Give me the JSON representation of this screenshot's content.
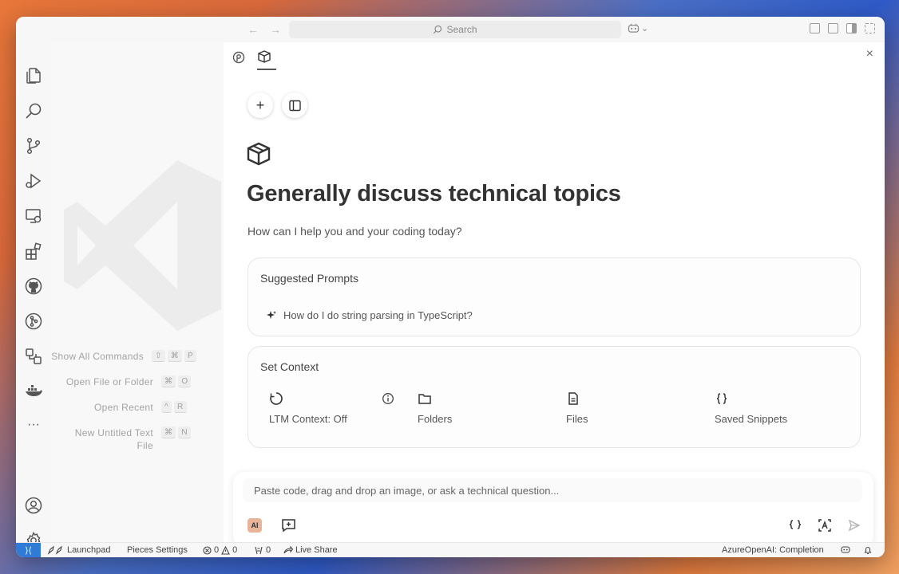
{
  "titlebar": {
    "search_placeholder": "Search",
    "nav_back": "←",
    "nav_forward": "→",
    "copilot_chevron": "⌄"
  },
  "activity_bar": {
    "items": [
      "explorer-icon",
      "search-icon",
      "source-control-icon",
      "run-debug-icon",
      "remote-explorer-icon",
      "extensions-icon",
      "github-icon",
      "gitlens-icon",
      "pieces-icon",
      "docker-icon",
      "more-icon"
    ],
    "more_label": "···",
    "bottom": [
      "account-icon",
      "settings-gear-icon"
    ]
  },
  "welcome": {
    "commands": [
      {
        "label": "Show All Commands",
        "keys": [
          "⇧",
          "⌘",
          "P"
        ]
      },
      {
        "label": "Open File or Folder",
        "keys": [
          "⌘",
          "O"
        ]
      },
      {
        "label": "Open Recent",
        "keys": [
          "^",
          "R"
        ]
      },
      {
        "label": "New Untitled Text File",
        "keys": [
          "⌘",
          "N"
        ]
      }
    ]
  },
  "chat": {
    "close_label": "×",
    "new_chat_label": "+",
    "title": "Generally discuss technical topics",
    "subtitle": "How can I help you and your coding today?",
    "suggested": {
      "title": "Suggested Prompts",
      "items": [
        "How do I do string parsing in TypeScript?"
      ]
    },
    "context": {
      "title": "Set Context",
      "items": [
        {
          "label": "LTM Context: Off",
          "icon": "ltm-icon"
        },
        {
          "label": "Folders",
          "icon": "folder-icon"
        },
        {
          "label": "Files",
          "icon": "file-icon"
        },
        {
          "label": "Saved Snippets",
          "icon": "snippets-icon"
        }
      ]
    },
    "composer": {
      "placeholder": "Paste code, drag and drop an image, or ask a technical question...",
      "model_badge": "AI"
    }
  },
  "statusbar": {
    "remote_label": "⟩⟨",
    "launchpad": "Launchpad",
    "pieces_settings": "Pieces Settings",
    "errors": "0",
    "warnings": "0",
    "ports": "0",
    "live_share": "Live Share",
    "completion": "AzureOpenAI: Completion"
  },
  "colors": {
    "accent": "#2f7bd6",
    "window_bg": "#ffffff",
    "chrome_bg": "#f7f7f7"
  }
}
